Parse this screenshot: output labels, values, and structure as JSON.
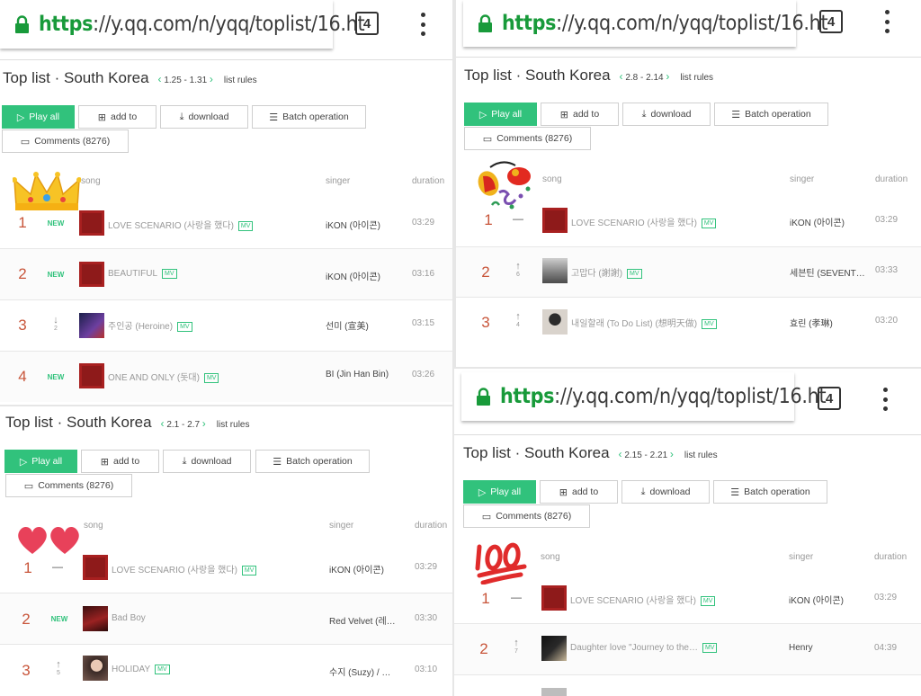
{
  "colors": {
    "accent": "#31c27c",
    "https": "#189a3a",
    "rank": "#c8553a"
  },
  "browser": {
    "https": "https",
    "rest": "://y.qq.com/n/yqq/toplist/16.ht",
    "tabs": "4"
  },
  "labels": {
    "title": "Top list · South Korea",
    "rules": "list rules",
    "play_all": "Play all",
    "add_to": "add to",
    "download": "download",
    "batch": "Batch operation",
    "comments": "Comments (8276)",
    "col_song": "song",
    "col_singer": "singer",
    "col_duration": "duration",
    "mv": "MV"
  },
  "panels": [
    {
      "range": "1.25 - 1.31",
      "emoji": "crown-emoji",
      "rows": [
        {
          "rank": "1",
          "change": "NEW",
          "song": "LOVE SCENARIO (사랑을 했다)",
          "mv": true,
          "singer": "iKON (아이콘)",
          "duration": "03:29"
        },
        {
          "rank": "2",
          "change": "NEW",
          "song": "BEAUTIFUL",
          "mv": true,
          "singer": "iKON (아이콘)",
          "duration": "03:16"
        },
        {
          "rank": "3",
          "change": "↓",
          "change_num": "2",
          "song": "주인공 (Heroine)",
          "mv": true,
          "singer": "선미 (宣美)",
          "duration": "03:15"
        },
        {
          "rank": "4",
          "change": "NEW",
          "song": "ONE AND ONLY (돗대)",
          "mv": true,
          "singer": "BI (Jin Han Bin)",
          "duration": "03:26"
        }
      ]
    },
    {
      "range": "2.1 - 2.7",
      "emoji": "hearts-emoji",
      "rows": [
        {
          "rank": "1",
          "change": "—",
          "song": "LOVE SCENARIO (사랑을 했다)",
          "mv": true,
          "singer": "iKON (아이콘)",
          "duration": "03:29"
        },
        {
          "rank": "2",
          "change": "NEW",
          "song": "Bad Boy",
          "mv": false,
          "singer": "Red Velvet (레…",
          "duration": "03:30"
        },
        {
          "rank": "3",
          "change": "↑",
          "change_num": "5",
          "song": "HOLIDAY",
          "mv": true,
          "singer": "수지 (Suzy) / …",
          "duration": "03:10"
        }
      ]
    },
    {
      "range": "2.8 - 2.14",
      "emoji": "party-emoji",
      "rows": [
        {
          "rank": "1",
          "change": "—",
          "song": "LOVE SCENARIO (사랑을 했다)",
          "mv": true,
          "singer": "iKON (아이콘)",
          "duration": "03:29"
        },
        {
          "rank": "2",
          "change": "↑",
          "change_num": "6",
          "song": "고맙다 (謝謝)",
          "mv": true,
          "singer": "세븐틴 (SEVENT…",
          "duration": "03:33"
        },
        {
          "rank": "3",
          "change": "↑",
          "change_num": "4",
          "song": "내일할래 (To Do List) (想明天做)",
          "mv": true,
          "singer": "효린 (孝琳)",
          "duration": "03:20"
        }
      ]
    },
    {
      "range": "2.15 - 2.21",
      "emoji": "hundred-points-emoji",
      "rows": [
        {
          "rank": "1",
          "change": "—",
          "song": "LOVE SCENARIO (사랑을 했다)",
          "mv": true,
          "singer": "iKON (아이콘)",
          "duration": "03:29"
        },
        {
          "rank": "2",
          "change": "↑",
          "change_num": "7",
          "song": "Daughter love   \"Journey to the…",
          "mv": true,
          "singer": "Henry",
          "duration": "04:39"
        }
      ]
    }
  ]
}
